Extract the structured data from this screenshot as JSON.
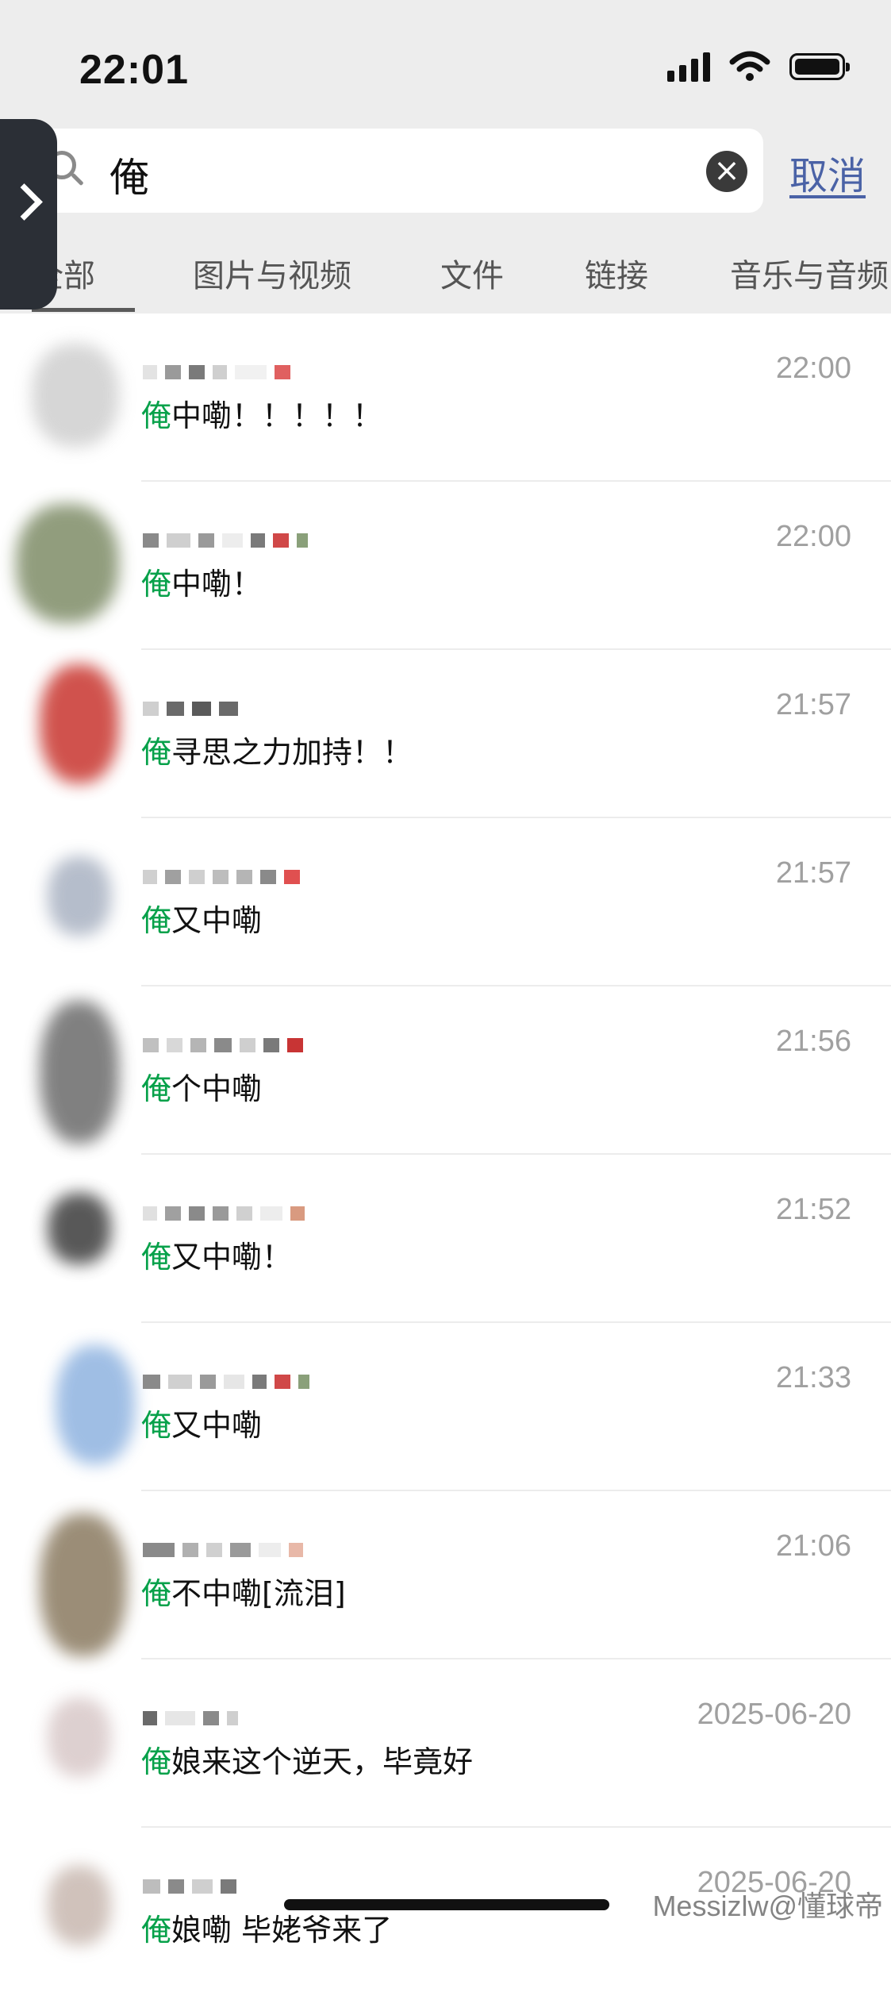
{
  "status_bar": {
    "time": "22:01",
    "icons": [
      "signal-icon",
      "wifi-icon",
      "battery-icon"
    ]
  },
  "search": {
    "value": "俺",
    "cancel_label": "取消"
  },
  "tabs": [
    {
      "label": "全部",
      "active": true
    },
    {
      "label": "图片与视频",
      "active": false
    },
    {
      "label": "文件",
      "active": false
    },
    {
      "label": "链接",
      "active": false
    },
    {
      "label": "音乐与音频",
      "active": false
    }
  ],
  "results": [
    {
      "keyword": "俺",
      "rest": "中嘞！！！！！",
      "time": "22:00"
    },
    {
      "keyword": "俺",
      "rest": "中嘞！",
      "time": "22:00"
    },
    {
      "keyword": "俺",
      "rest": "寻思之力加持！！",
      "time": "21:57"
    },
    {
      "keyword": "俺",
      "rest": "又中嘞",
      "time": "21:57"
    },
    {
      "keyword": "俺",
      "rest": "个中嘞",
      "time": "21:56"
    },
    {
      "keyword": "俺",
      "rest": "又中嘞！",
      "time": "21:52"
    },
    {
      "keyword": "俺",
      "rest": "又中嘞",
      "time": "21:33"
    },
    {
      "keyword": "俺",
      "rest": "不中嘞[流泪]",
      "time": "21:06"
    },
    {
      "keyword": "俺",
      "rest": "娘来这个逆天，毕竟好",
      "time": "2025-06-20"
    },
    {
      "keyword": "俺",
      "rest": "娘嘞 毕姥爷来了",
      "time": "2025-06-20"
    }
  ],
  "watermark": "Messizlw@懂球帝",
  "colors": {
    "highlight": "#07a14a",
    "cancel": "#4a62a6",
    "header_bg": "#ededed"
  }
}
